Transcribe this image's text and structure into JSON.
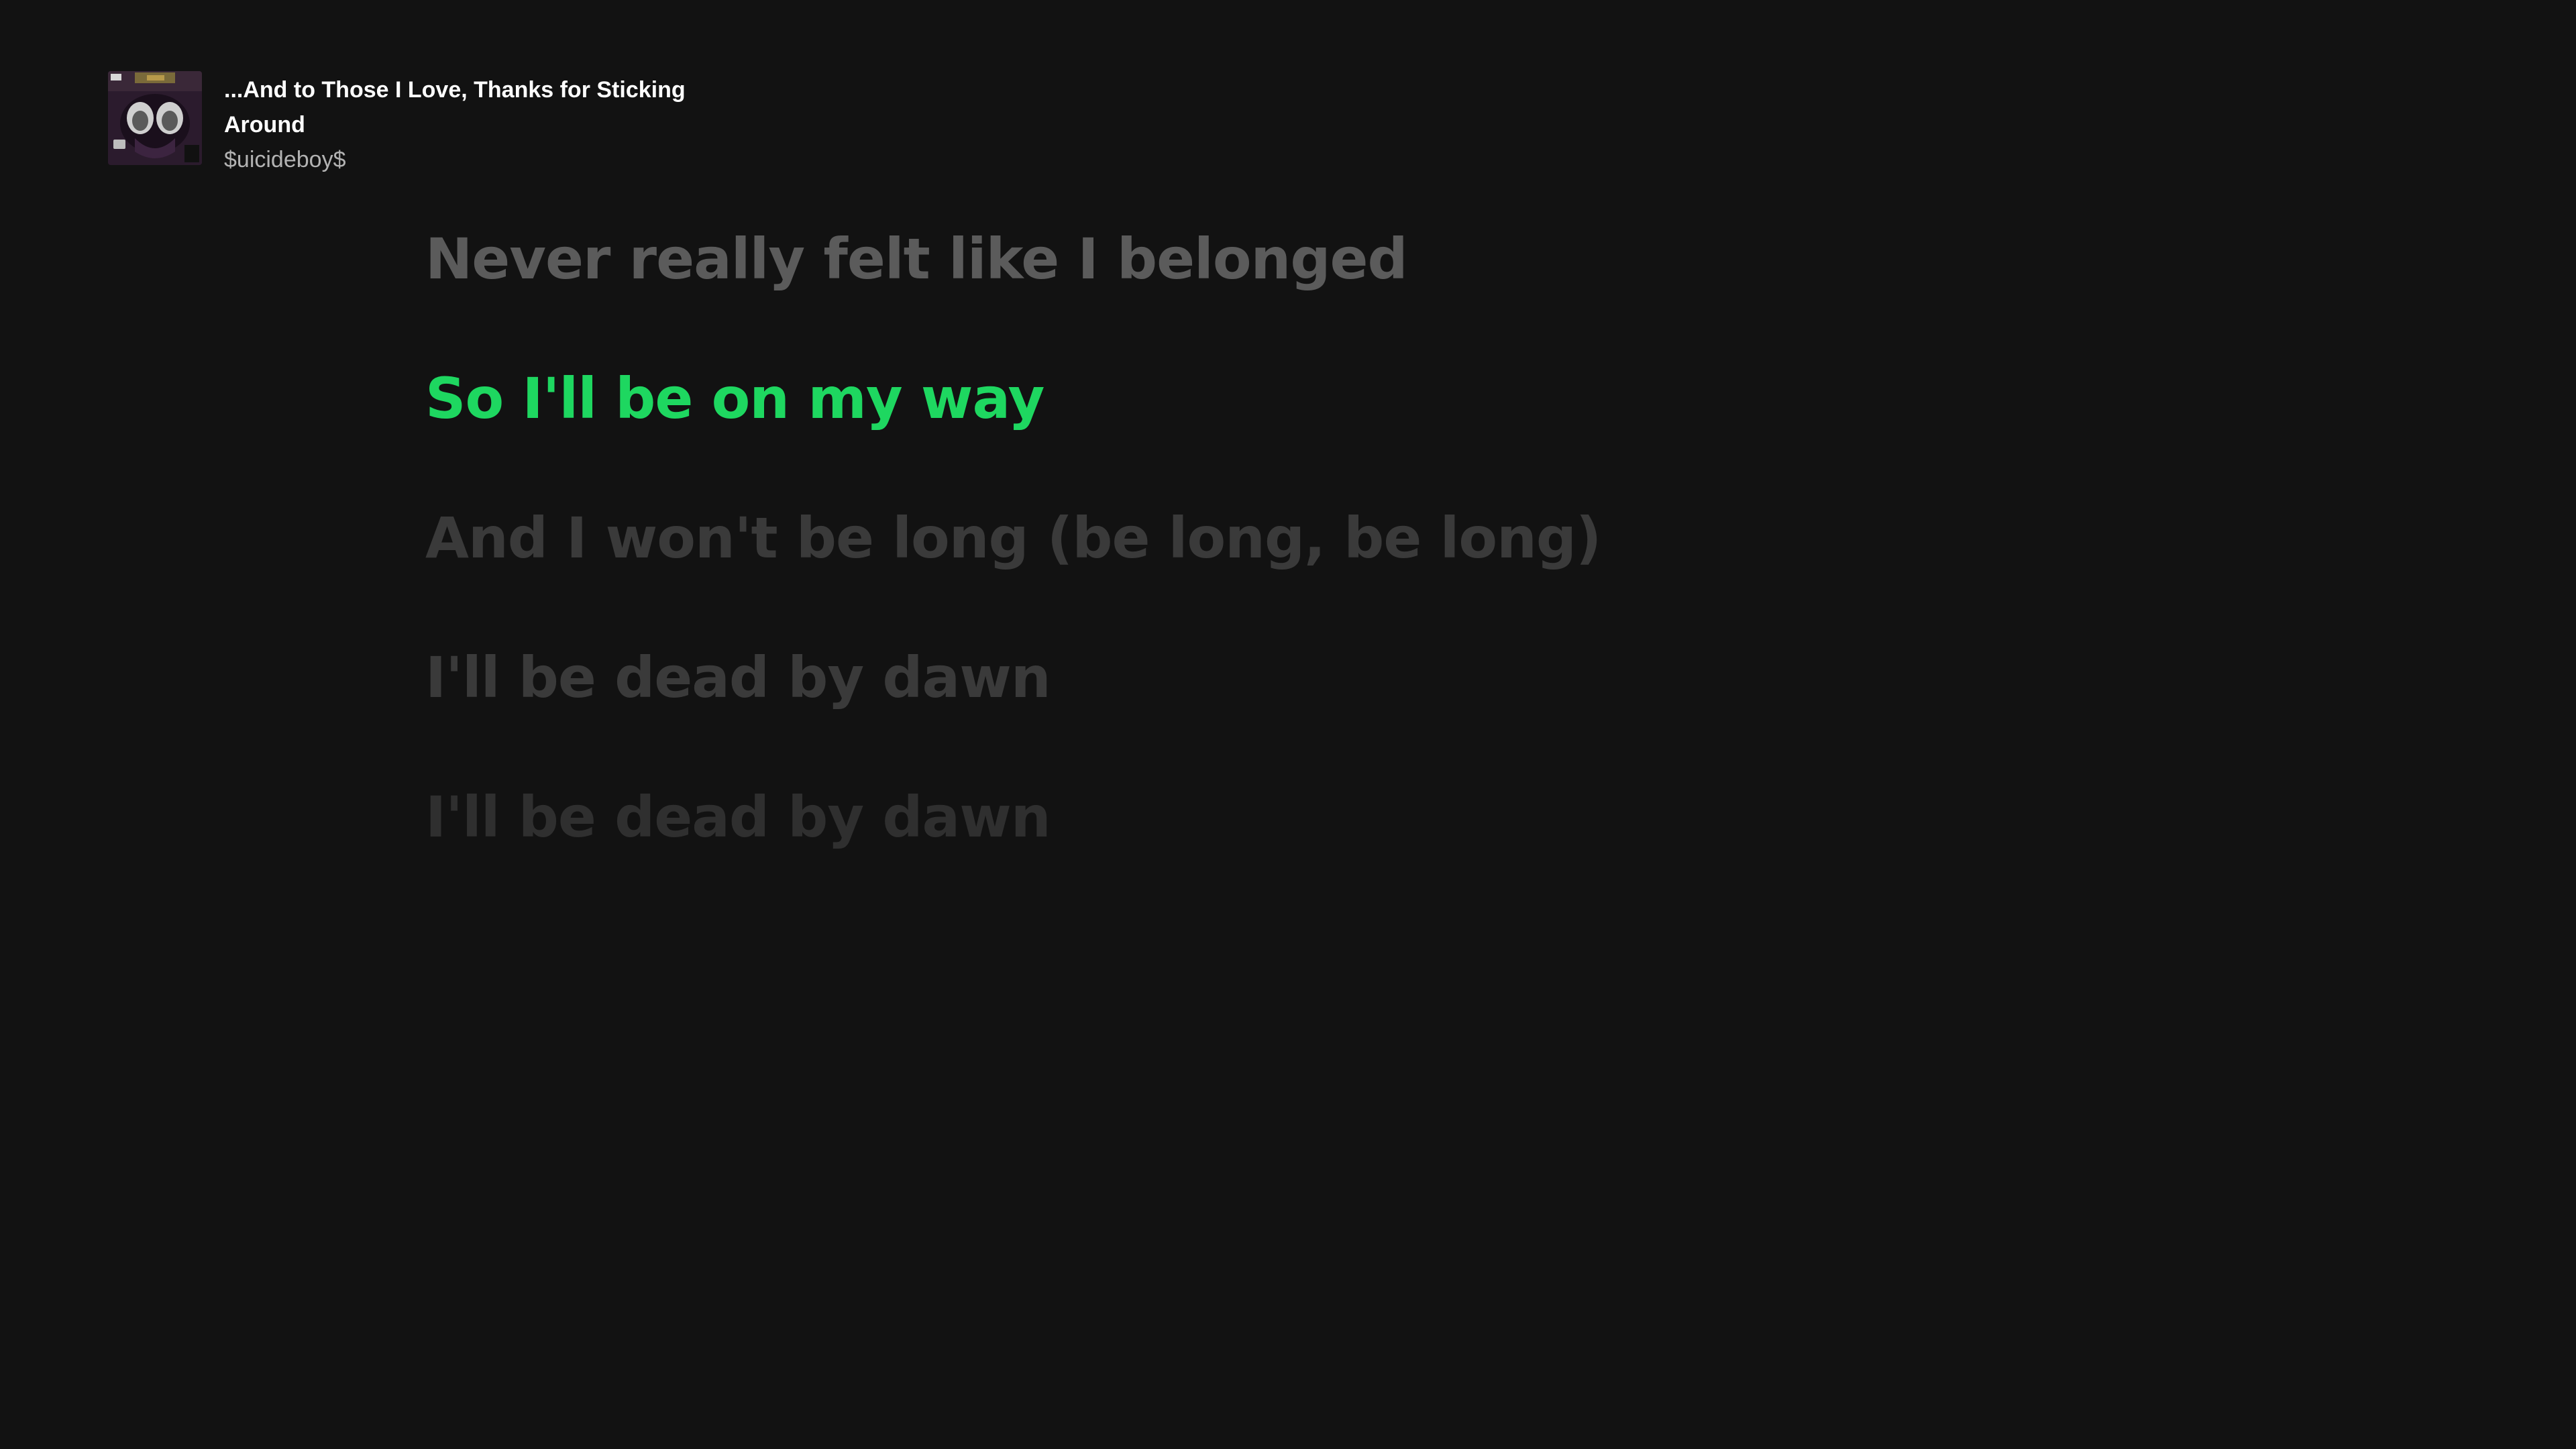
{
  "track": {
    "title": "...And to Those I Love, Thanks for Sticking Around",
    "artist": "$uicideboy$"
  },
  "lyrics": {
    "lines": [
      {
        "text": "Never really felt like I belonged",
        "state": "past"
      },
      {
        "text": "So I'll be on my way",
        "state": "active"
      },
      {
        "text": "And I won't be long (be long, be long)",
        "state": "upcoming"
      },
      {
        "text": "I'll be dead by dawn",
        "state": "upcoming"
      },
      {
        "text": "I'll be dead by dawn",
        "state": "fading"
      }
    ]
  },
  "colors": {
    "background": "#121212",
    "active_lyric": "#1ed760",
    "past_lyric": "#5b5b5b",
    "upcoming_lyric": "#3a3a3a",
    "title": "#ffffff",
    "artist": "#b3b3b3"
  },
  "icons": {
    "album_art": "album-art-image"
  }
}
